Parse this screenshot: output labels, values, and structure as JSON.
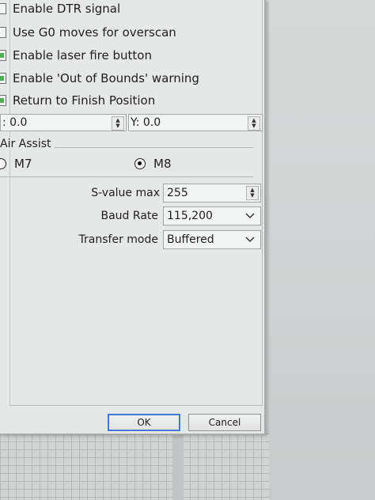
{
  "checkboxes": [
    {
      "label": "Enable DTR signal",
      "checked": false
    },
    {
      "label": "Use G0 moves for overscan",
      "checked": false
    },
    {
      "label": "Enable laser fire button",
      "checked": true
    },
    {
      "label": "Enable 'Out of Bounds' warning",
      "checked": true
    },
    {
      "label": "Return to Finish Position",
      "checked": true
    }
  ],
  "finish_position": {
    "x_value": ": 0.0",
    "y_value": "Y: 0.0"
  },
  "air_assist": {
    "title": "Air Assist",
    "options": [
      {
        "label": "M7",
        "selected": false
      },
      {
        "label": "M8",
        "selected": true
      }
    ]
  },
  "settings": {
    "s_value_max": {
      "label": "S-value max",
      "value": "255"
    },
    "baud_rate": {
      "label": "Baud Rate",
      "value": "115,200"
    },
    "transfer_mode": {
      "label": "Transfer mode",
      "value": "Buffered"
    }
  },
  "buttons": {
    "ok": "OK",
    "cancel": "Cancel"
  },
  "icons": {
    "spin": "spin-arrows-icon",
    "dropdown": "chevron-down-icon"
  }
}
